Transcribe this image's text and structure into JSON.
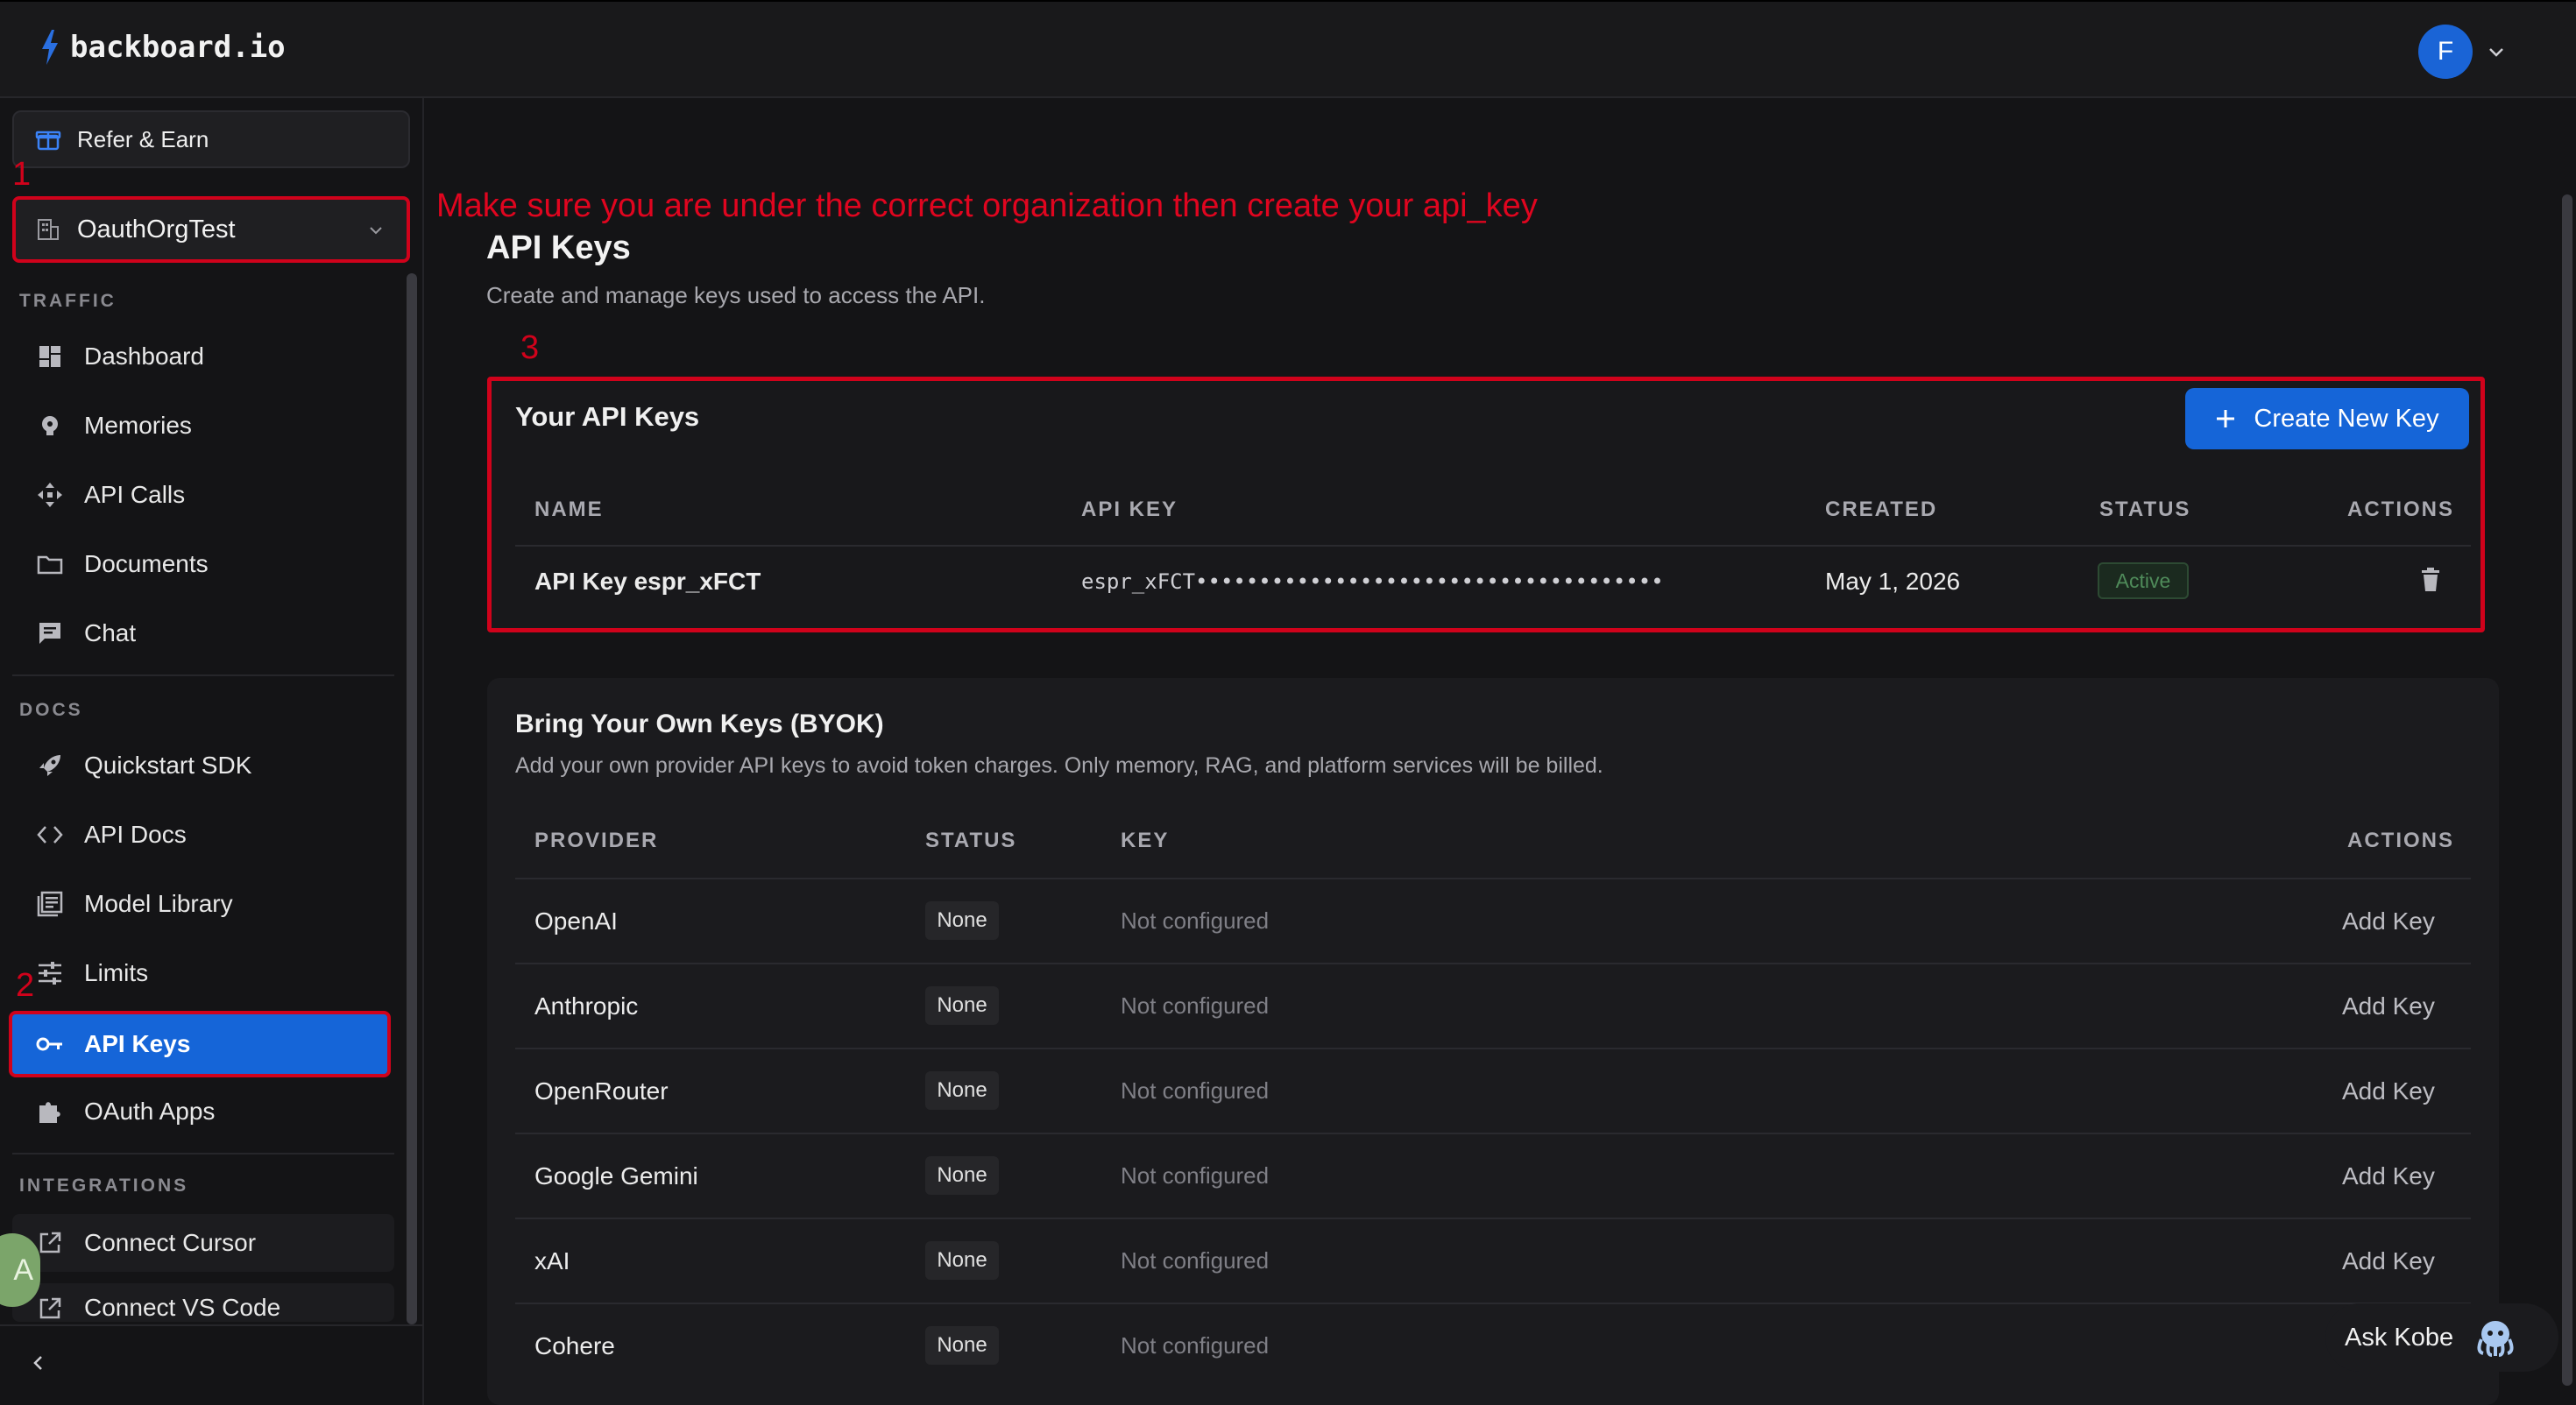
{
  "header": {
    "logo_text": "backboard.io",
    "avatar_initial": "F"
  },
  "sidebar": {
    "refer_label": "Refer & Earn",
    "org_name": "OauthOrgTest",
    "sections": {
      "traffic": "TRAFFIC",
      "docs": "DOCS",
      "integrations": "INTEGRATIONS"
    },
    "traffic_items": [
      "Dashboard",
      "Memories",
      "API Calls",
      "Documents",
      "Chat"
    ],
    "docs_items": [
      "Quickstart SDK",
      "API Docs",
      "Model Library",
      "Limits",
      "API Keys",
      "OAuth Apps"
    ],
    "integration_items": [
      "Connect Cursor",
      "Connect VS Code"
    ],
    "active_item": "API Keys",
    "help_avatar_initial": "A"
  },
  "annotations": {
    "marker_1": "1",
    "marker_2": "2",
    "marker_3": "3",
    "instruction": "Make sure you are under the correct organization then create your api_key",
    "annotation_color": "#d0021b"
  },
  "main": {
    "title": "API Keys",
    "subtitle": "Create and manage keys used to access the API.",
    "keys_card": {
      "title": "Your API Keys",
      "create_button": "Create New Key",
      "columns": [
        "NAME",
        "API KEY",
        "CREATED",
        "STATUS",
        "ACTIONS"
      ],
      "rows": [
        {
          "name": "API Key espr_xFCT",
          "key": "espr_xFCT•••••••••••••••••••••••••••••••••••••",
          "created": "May 1, 2026",
          "status": "Active"
        }
      ]
    },
    "byok_card": {
      "title": "Bring Your Own Keys (BYOK)",
      "subtitle": "Add your own provider API keys to avoid token charges. Only memory, RAG, and platform services will be billed.",
      "columns": [
        "PROVIDER",
        "STATUS",
        "KEY",
        "ACTIONS"
      ],
      "rows": [
        {
          "provider": "OpenAI",
          "status": "None",
          "key": "Not configured",
          "action": "Add Key"
        },
        {
          "provider": "Anthropic",
          "status": "None",
          "key": "Not configured",
          "action": "Add Key"
        },
        {
          "provider": "OpenRouter",
          "status": "None",
          "key": "Not configured",
          "action": "Add Key"
        },
        {
          "provider": "Google Gemini",
          "status": "None",
          "key": "Not configured",
          "action": "Add Key"
        },
        {
          "provider": "xAI",
          "status": "None",
          "key": "Not configured",
          "action": "Add Key"
        },
        {
          "provider": "Cohere",
          "status": "None",
          "key": "Not configured",
          "action": "Add Key"
        }
      ]
    },
    "ask_button": "Ask Kobe"
  },
  "colors": {
    "accent": "#1565d8",
    "background": "#141416",
    "annotation_red": "#d0021b",
    "active_green": "#4f8b5a"
  }
}
